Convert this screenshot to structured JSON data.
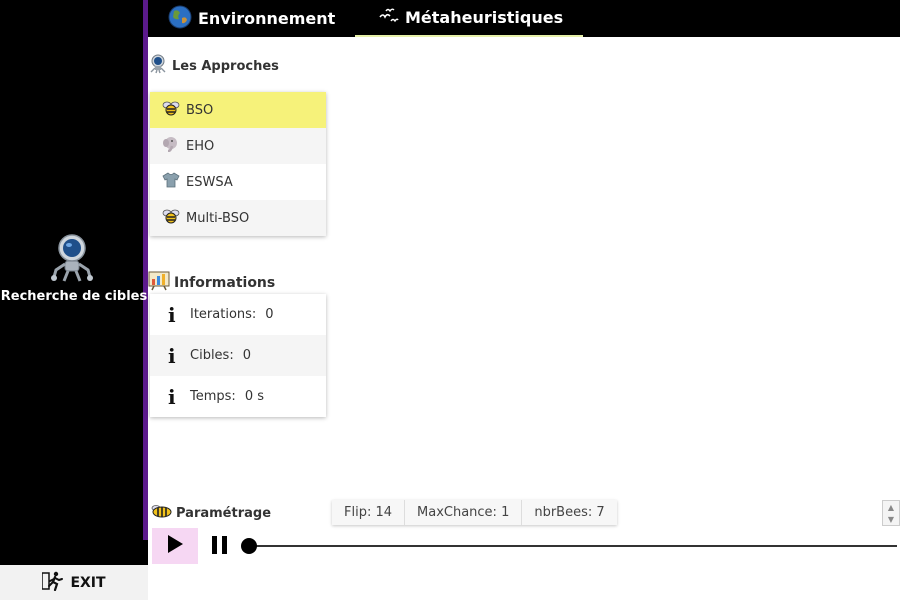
{
  "sidebar": {
    "title": "Recherche de cibles",
    "robot_icon": "robot-icon",
    "exit_label": "EXIT",
    "exit_icon": "running-man-icon",
    "accent_color": "#5c1a8c"
  },
  "tabs": [
    {
      "label": "Environnement",
      "icon": "globe-icon",
      "active": false
    },
    {
      "label": "Métaheuristiques",
      "icon": "birds-icon",
      "active": true
    }
  ],
  "approaches": {
    "header": "Les Approches",
    "header_icon": "robot-icon",
    "selected_color": "#f6f27a",
    "items": [
      {
        "label": "BSO",
        "icon": "bee-icon",
        "selected": true
      },
      {
        "label": "EHO",
        "icon": "elephant-icon",
        "selected": false
      },
      {
        "label": "ESWSA",
        "icon": "shirt-icon",
        "selected": false
      },
      {
        "label": "Multi-BSO",
        "icon": "bee-icon",
        "selected": false
      }
    ]
  },
  "informations": {
    "header": "Informations",
    "header_icon": "chart-board-icon",
    "rows": [
      {
        "label": "Iterations:",
        "value": "0"
      },
      {
        "label": "Cibles:",
        "value": "0"
      },
      {
        "label": "Temps:",
        "value": "0 s"
      }
    ]
  },
  "parametrage": {
    "header": "Paramétrage",
    "header_icon": "bee-icon",
    "params": [
      "Flip: 14",
      "MaxChance: 1",
      "nbrBees: 7"
    ]
  },
  "player": {
    "play_icon": "play-icon",
    "pause_icon": "pause-icon",
    "progress": 0
  }
}
